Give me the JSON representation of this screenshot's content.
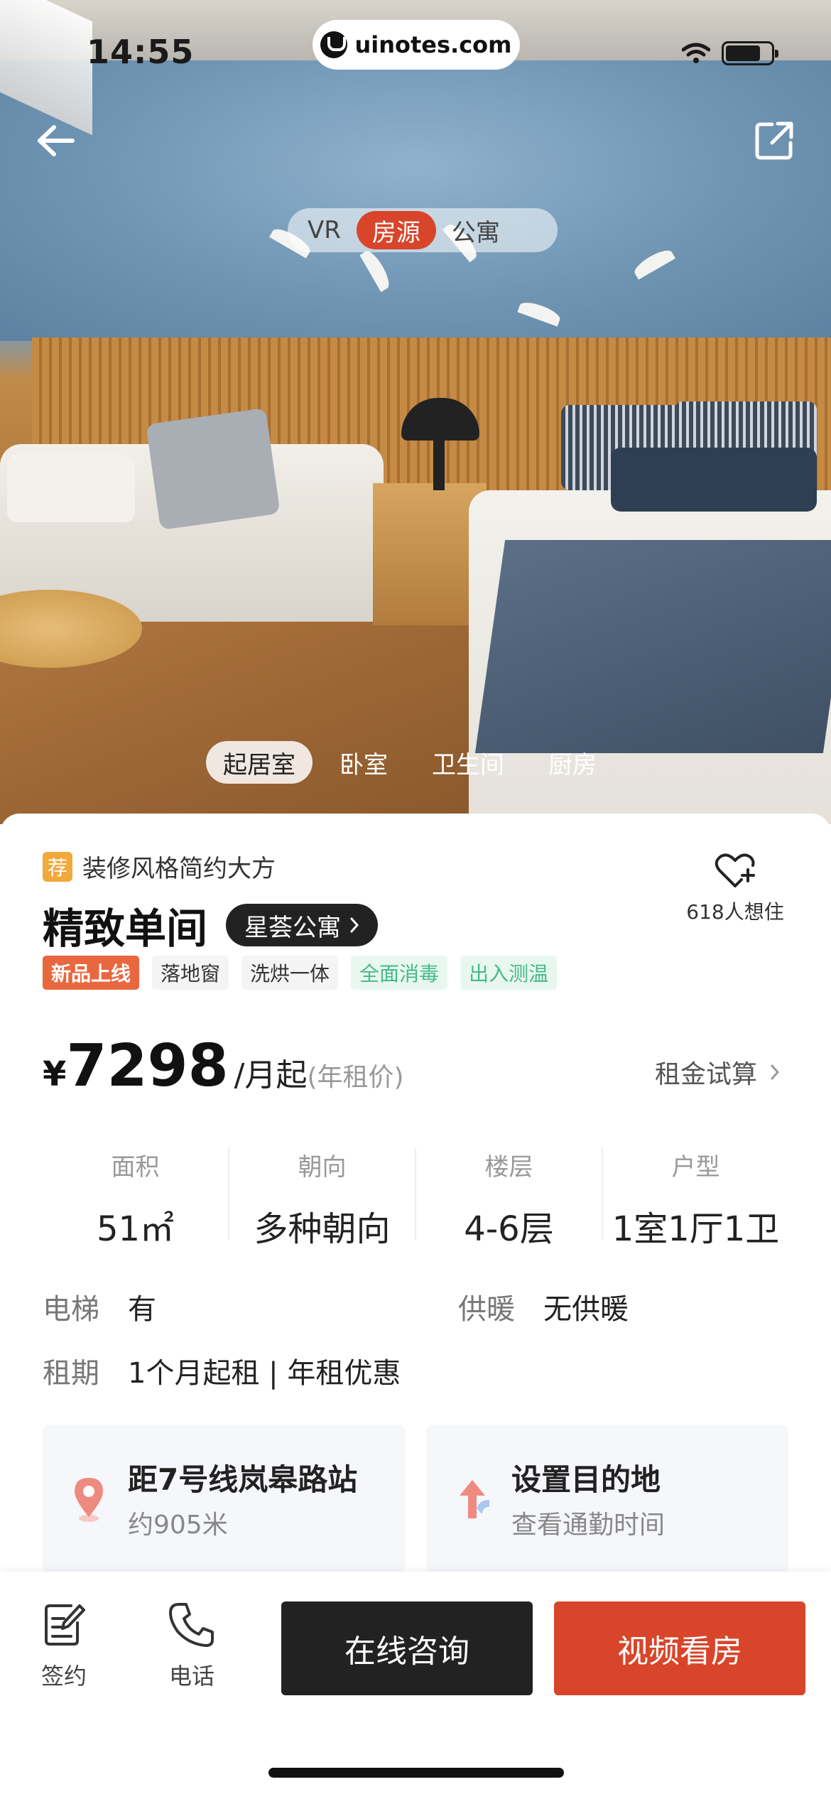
{
  "status_bar": {
    "time": "14:55",
    "watermark": "uinotes.com"
  },
  "hero": {
    "segments": [
      {
        "label": "VR",
        "active": false
      },
      {
        "label": "房源",
        "active": true
      },
      {
        "label": "公寓",
        "active": false
      }
    ],
    "room_tabs": [
      {
        "label": "起居室",
        "active": true
      },
      {
        "label": "卧室",
        "active": false
      },
      {
        "label": "卫生间",
        "active": false
      },
      {
        "label": "厨房",
        "active": false
      }
    ]
  },
  "listing": {
    "badge": "荐",
    "tagline": "装修风格简约大方",
    "title": "精致单间",
    "brand": "星荟公寓",
    "favorite_count": "618人想住",
    "tags": [
      {
        "label": "新品上线",
        "style": "new"
      },
      {
        "label": "落地窗",
        "style": "gray"
      },
      {
        "label": "洗烘一体",
        "style": "gray"
      },
      {
        "label": "全面消毒",
        "style": "green"
      },
      {
        "label": "出入测温",
        "style": "green"
      }
    ],
    "price": {
      "currency": "¥",
      "amount": "7298",
      "unit": "/月起",
      "note": "(年租价)",
      "calc_label": "租金试算"
    },
    "specs": [
      {
        "label": "面积",
        "value": "51㎡"
      },
      {
        "label": "朝向",
        "value": "多种朝向"
      },
      {
        "label": "楼层",
        "value": "4-6层"
      },
      {
        "label": "户型",
        "value": "1室1厅1卫"
      }
    ],
    "info": {
      "elevator_label": "电梯",
      "elevator_value": "有",
      "heating_label": "供暖",
      "heating_value": "无供暖",
      "lease_label": "租期",
      "lease_value": "1个月起租 | 年租优惠"
    },
    "location": {
      "station_title": "距7号线岚皋路站",
      "station_distance": "约905米",
      "dest_title": "设置目的地",
      "dest_sub": "查看通勤时间"
    }
  },
  "bottom_bar": {
    "sign_label": "签约",
    "phone_label": "电话",
    "consult_label": "在线咨询",
    "video_label": "视频看房"
  },
  "colors": {
    "accent": "#d9452a",
    "dark_button": "#222222",
    "green_tag": "#45b98b",
    "badge": "#f2a93b"
  }
}
